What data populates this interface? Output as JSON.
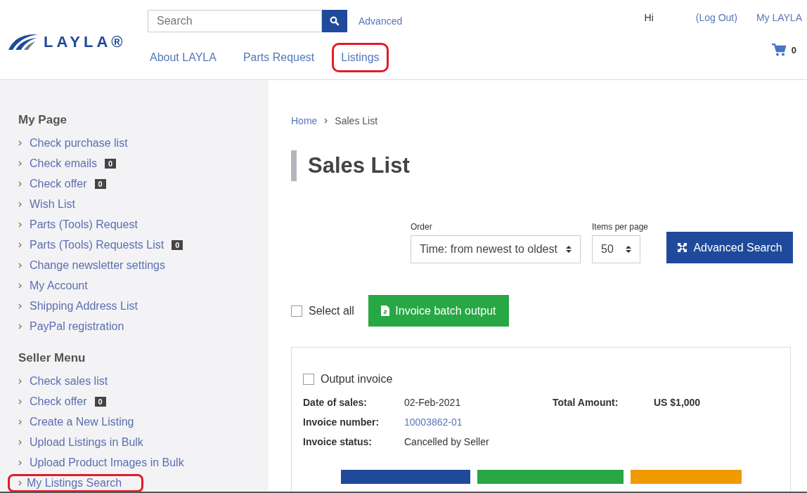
{
  "header": {
    "logo": "LAYLA®",
    "search": {
      "placeholder": "Search"
    },
    "advanced_link": "Advanced",
    "nav": [
      {
        "label": "About LAYLA",
        "circled": false
      },
      {
        "label": "Parts Request",
        "circled": false
      },
      {
        "label": "Listings",
        "circled": true
      }
    ],
    "greeting": "Hi",
    "logout": "(Log Out)",
    "my_layla": "My LAYLA",
    "cart_count": "0"
  },
  "sidebar": {
    "sections": [
      {
        "title": "My Page",
        "items": [
          {
            "label": "Check purchase list",
            "circled": false
          },
          {
            "label": "Check emails",
            "badge": "0",
            "circled": false
          },
          {
            "label": "Check offer",
            "badge": "0",
            "circled": false
          },
          {
            "label": "Wish List",
            "circled": false
          },
          {
            "label": "Parts (Tools) Request",
            "circled": false
          },
          {
            "label": "Parts (Tools) Requests List",
            "badge": "0",
            "circled": false
          },
          {
            "label": "Change newsletter settings",
            "circled": false
          },
          {
            "label": "My Account",
            "circled": false
          },
          {
            "label": "Shipping Address List",
            "circled": false
          },
          {
            "label": "PayPal registration",
            "circled": false
          }
        ]
      },
      {
        "title": "Seller Menu",
        "items": [
          {
            "label": "Check sales list",
            "circled": false
          },
          {
            "label": "Check offer",
            "badge": "0",
            "circled": false
          },
          {
            "label": "Create a New Listing",
            "circled": false
          },
          {
            "label": "Upload Listings in Bulk",
            "circled": false
          },
          {
            "label": "Upload Product Images in Bulk",
            "circled": false
          },
          {
            "label": "My Listings Search",
            "circled": true
          }
        ]
      }
    ]
  },
  "breadcrumb": [
    "Home",
    "Sales List"
  ],
  "title": "Sales List",
  "filters": {
    "order": {
      "label": "Order",
      "value": "Time: from newest to oldest"
    },
    "per_page": {
      "label": "Items per page",
      "value": "50"
    },
    "advanced_search": "Advanced Search"
  },
  "select_all": {
    "label": "Select all",
    "checked": false
  },
  "batch_button": "Invoice batch output",
  "invoice": {
    "output": {
      "label": "Output invoice",
      "checked": false
    },
    "fields": [
      {
        "label": "Date of sales:",
        "value": "02-Feb-2021",
        "kind": "text"
      },
      {
        "label": "Invoice number:",
        "value": "10003862-01",
        "kind": "link"
      },
      {
        "label": "Invoice status:",
        "value": "Cancelled by Seller",
        "kind": "text"
      }
    ],
    "total": {
      "label": "Total Amount:",
      "value": "US $1,000"
    },
    "action_buttons": [
      {
        "color": "#1f4a9c"
      },
      {
        "color": "#28a745"
      },
      {
        "color": "#f09a00"
      }
    ]
  }
}
